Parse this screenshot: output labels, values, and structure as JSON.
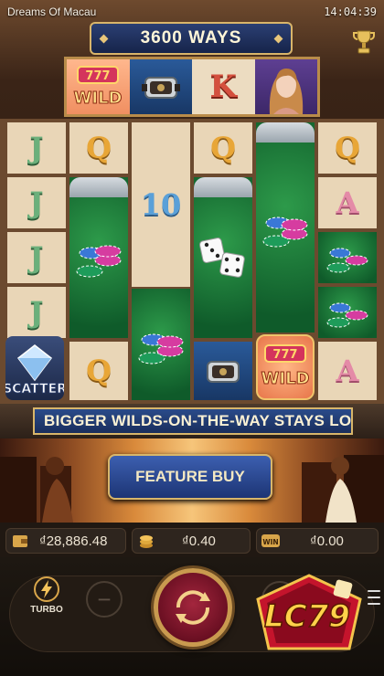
{
  "header": {
    "game_title": "Dreams Of Macau",
    "time": "14:04:39"
  },
  "ways": {
    "label": "3600  WAYS"
  },
  "top_reel": [
    {
      "symbol": "WILD",
      "icon": "wild-icon",
      "label": "WILD"
    },
    {
      "symbol": "watch",
      "icon": "watch-icon"
    },
    {
      "symbol": "K",
      "label": "K"
    },
    {
      "symbol": "lady",
      "icon": "lady-portrait-icon"
    }
  ],
  "grid": {
    "col1": [
      "J",
      "J",
      "J",
      "J",
      "SCATTER"
    ],
    "col2": [
      "Q",
      "chips",
      "Q"
    ],
    "col3": [
      "",
      "10",
      "chips"
    ],
    "col4": [
      "Q",
      "dice",
      "watch"
    ],
    "col5": [
      "chips",
      "WILD"
    ],
    "col6": [
      "Q",
      "A",
      "chips",
      "chips",
      "A"
    ],
    "scatter_label": "SCATTER",
    "wild_label": "WILD"
  },
  "banner": {
    "text": "BIGGER WILDS-ON-THE-WAY STAYS LO"
  },
  "feature_buy": {
    "label": "FEATURE BUY"
  },
  "balance": {
    "balance_value": "₫28,886.48",
    "bet_value": "₫0.40",
    "win_value": "₫0.00",
    "win_badge": "WIN"
  },
  "controls": {
    "turbo_label": "TURBO",
    "minus": "−",
    "plus": "+"
  },
  "logo": {
    "text": "LC79"
  },
  "colors": {
    "gold": "#d8b66a",
    "navy": "#1d3575",
    "spin_red": "#a3263d",
    "green_felt": "#2d9a4a"
  }
}
